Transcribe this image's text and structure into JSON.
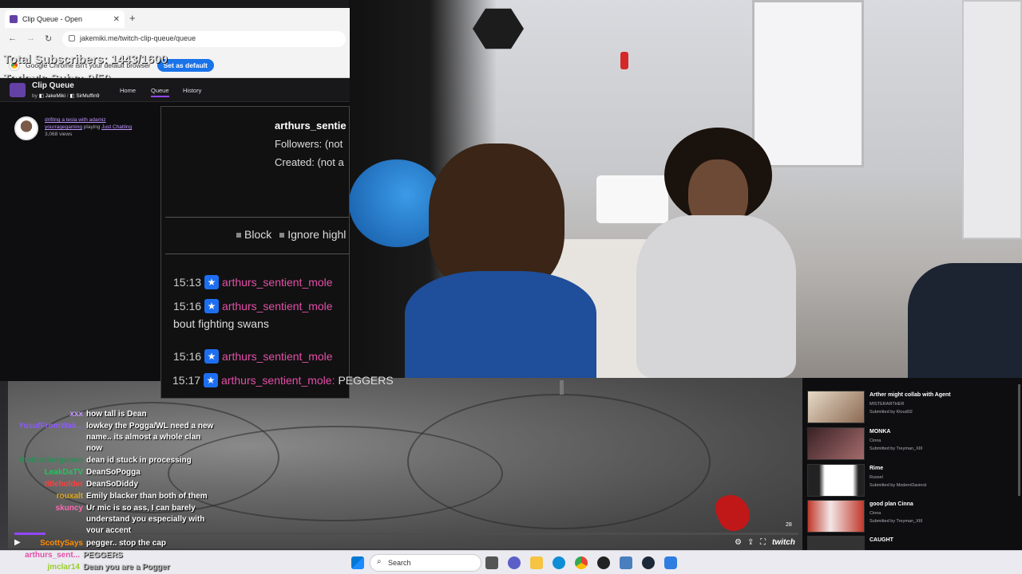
{
  "browser": {
    "tab_title": "Clip Queue - Open",
    "url": "jakemiki.me/twitch-clip-queue/queue",
    "infobar_text": "Google Chrome isn't your default browser",
    "set_default_label": "Set as default"
  },
  "overlay": {
    "total_subs": "Total Subscribers: 1443/1600",
    "today_subs": "Today's Subs: 9/50"
  },
  "clip_queue": {
    "title": "Clip Queue",
    "by": "by",
    "author1": "JakeMiki",
    "author2": "SirMuffin9",
    "nav": [
      "Home",
      "Queue",
      "History"
    ],
    "current_clip": {
      "title": "drifitng a tesla with adamiz",
      "channel": "yourragegaming",
      "playing_prefix": "playing",
      "category": "Just Chatting",
      "views": "3,068 views"
    }
  },
  "popup": {
    "username": "arthurs_sentie",
    "followers": "Followers: (not",
    "created": "Created: (not a",
    "block_label": "Block",
    "ignore_label": "Ignore highl",
    "messages": [
      {
        "time": "15:13",
        "user": "arthurs_sentient_mole",
        "text": ""
      },
      {
        "time": "15:16",
        "user": "arthurs_sentient_mole",
        "text": "bout fighting swans"
      },
      {
        "time": "15:16",
        "user": "arthurs_sentient_mole",
        "text": ""
      }
    ],
    "last": {
      "time": "15:17",
      "user": "arthurs_sentient_mole:",
      "text": "PEGGERS"
    }
  },
  "chat": [
    {
      "name": "xxx",
      "color": "#bf94ff",
      "text": "how tall is Dean"
    },
    {
      "name": "YusufFromWak...",
      "color": "#8a5cf6",
      "text": "lowkey the Pogga/WL need a new name.. its almost a whole clan now"
    },
    {
      "name": "thebrotherganno",
      "color": "#2e8b57",
      "text": "dean id stuck in processing"
    },
    {
      "name": "LeakDaTV",
      "color": "#22c55e",
      "text": "DeanSoPogga"
    },
    {
      "name": "titleholder",
      "color": "#ff4040",
      "text": "DeanSoDiddy"
    },
    {
      "name": "rouxalt",
      "color": "#daa520",
      "text": "Emily blacker than both of them"
    },
    {
      "name": "skuncy",
      "color": "#ff69b4",
      "text": "Ur mic is so ass, I can barely understand you especially with your accent"
    },
    {
      "name": "ScottySays",
      "color": "#ff8c00",
      "text": "pegger.. stop the cap"
    },
    {
      "name": "arthurs_sent...",
      "color": "#e34fa8",
      "text": "PEGGERS"
    },
    {
      "name": "jmclar14",
      "color": "#9acd32",
      "text": "Dean you are a Pogger"
    }
  ],
  "player": {
    "timecode": "28",
    "brand": "twitch",
    "progress": 0.04
  },
  "queue": [
    {
      "title": "Arther might collab with Agent",
      "channel": "MISTERARTHER",
      "submitted": "Submitted by Kloud02"
    },
    {
      "title": "MONKA",
      "channel": "Cinna",
      "submitted": "Submitted by Treyman_XIII"
    },
    {
      "title": "Rime",
      "channel": "Russel",
      "submitted": "Submitted by ModernDavincii"
    },
    {
      "title": "good plan Cinna",
      "channel": "Cinna",
      "submitted": "Submitted by Treyman_XIII"
    },
    {
      "title": "CAUGHT",
      "channel": "",
      "submitted": ""
    }
  ],
  "taskbar": {
    "search_label": "Search"
  },
  "colors": {
    "twitch_purple": "#9147ff",
    "chrome_blue": "#1a73e8",
    "username_pink": "#e34fa8"
  }
}
